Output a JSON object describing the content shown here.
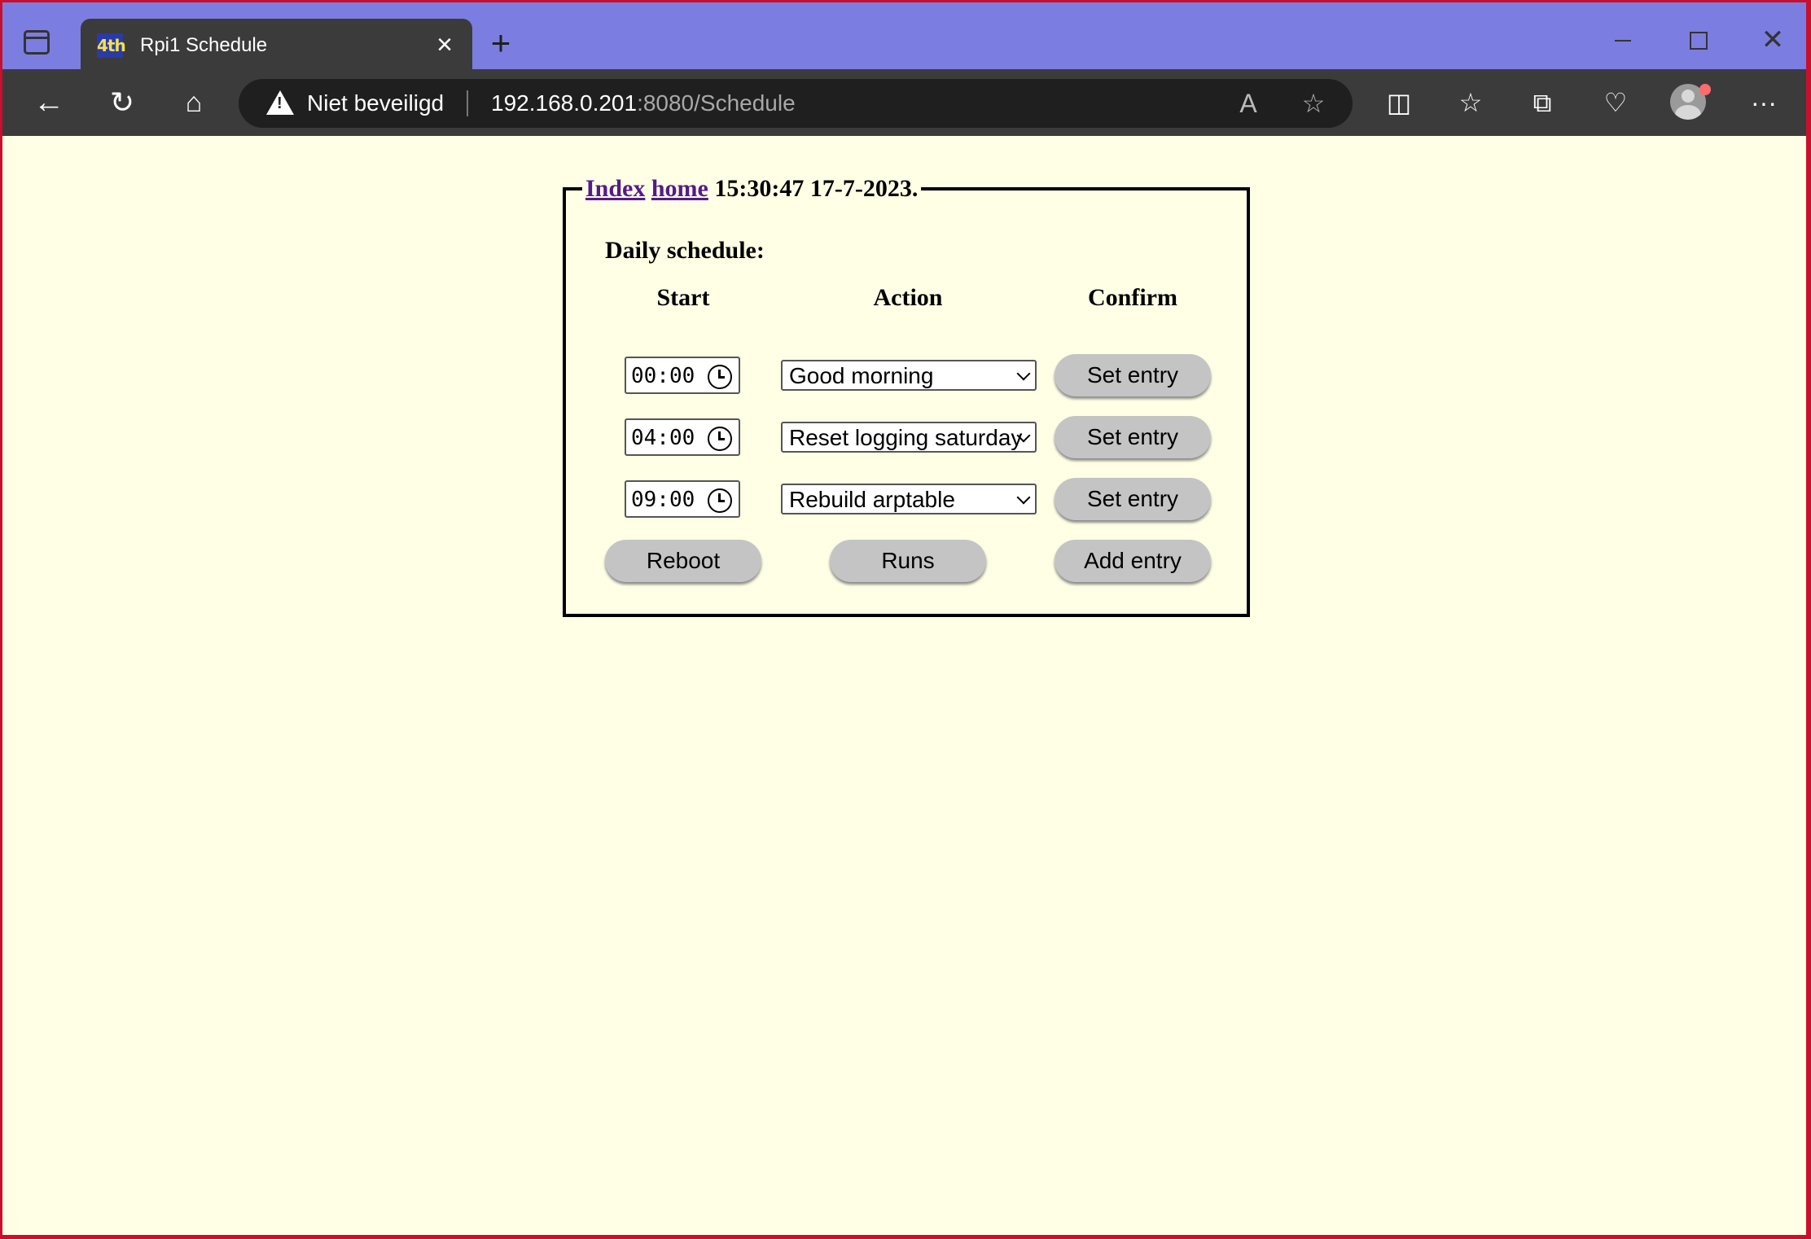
{
  "browser": {
    "tab_title": "Rpi1 Schedule",
    "tab_favicon": "4th",
    "security_label": "Niet beveiligd",
    "url_host": "192.168.0.201",
    "url_rest": ":8080/Schedule"
  },
  "page": {
    "legend": {
      "index_link": "Index",
      "home_link": "home",
      "datetime": "15:30:47 17-7-2023."
    },
    "title": "Daily schedule:",
    "columns": [
      "Start",
      "Action",
      "Confirm"
    ],
    "entries": [
      {
        "time": "00:00",
        "action": "Good morning",
        "button": "Set entry"
      },
      {
        "time": "04:00",
        "action": "Reset logging saturday",
        "button": "Set entry"
      },
      {
        "time": "09:00",
        "action": "Rebuild arptable",
        "button": "Set entry"
      }
    ],
    "footer_buttons": {
      "reboot": "Reboot",
      "runs": "Runs",
      "add_entry": "Add entry"
    }
  },
  "colors": {
    "page_bg": "#ffffe5",
    "tabbar_bg": "#7b7ee0",
    "toolbar_bg": "#3b3b3b",
    "link": "#551a8b",
    "button_bg": "#c4c4c4"
  }
}
